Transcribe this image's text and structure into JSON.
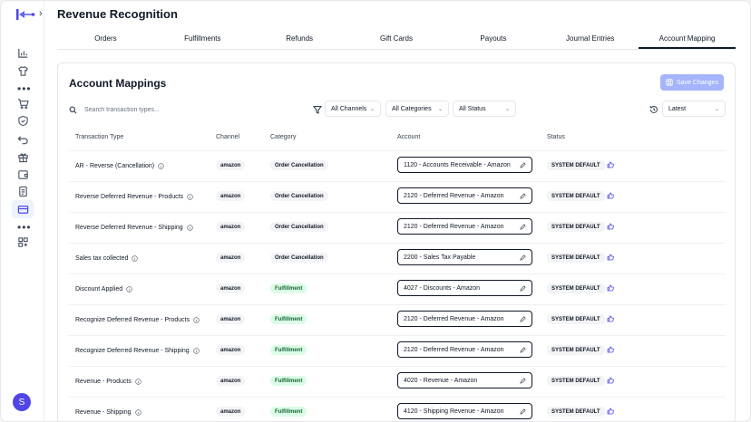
{
  "app": {
    "page_title": "Revenue Recognition",
    "user_initial": "S"
  },
  "tabs": [
    {
      "label": "Orders"
    },
    {
      "label": "Fulfillments"
    },
    {
      "label": "Refunds"
    },
    {
      "label": "Gift Cards"
    },
    {
      "label": "Payouts"
    },
    {
      "label": "Journal Entries"
    },
    {
      "label": "Account Mapping",
      "active": true
    }
  ],
  "panel": {
    "title": "Account Mappings",
    "save_label": "Save Changes",
    "search_placeholder": "Search transaction types...",
    "filters": {
      "channel": "All Channels",
      "category": "All Categories",
      "status": "All Status",
      "version": "Latest"
    }
  },
  "table": {
    "headers": {
      "type": "Transaction Type",
      "channel": "Channel",
      "category": "Category",
      "account": "Account",
      "status": "Status"
    },
    "rows": [
      {
        "type": "AR - Reverse (Cancellation)",
        "channel": "amazon",
        "category": "Order Cancellation",
        "account": "1120 - Accounts Receivable - Amazon",
        "status": "SYSTEM DEFAULT"
      },
      {
        "type": "Reverse Deferred Revenue - Products",
        "channel": "amazon",
        "category": "Order Cancellation",
        "account": "2120 - Deferred Revenue - Amazon",
        "status": "SYSTEM DEFAULT"
      },
      {
        "type": "Reverse Deferred Revenue - Shipping",
        "channel": "amazon",
        "category": "Order Cancellation",
        "account": "2120 - Deferred Revenue - Amazon",
        "status": "SYSTEM DEFAULT"
      },
      {
        "type": "Sales tax collected",
        "channel": "amazon",
        "category": "Order Cancellation",
        "account": "2200 - Sales Tax Payable",
        "status": "SYSTEM DEFAULT"
      },
      {
        "type": "Discount Applied",
        "channel": "amazon",
        "category": "Fulfillment",
        "account": "4027 - Discounts - Amazon",
        "status": "SYSTEM DEFAULT"
      },
      {
        "type": "Recognize Deferred Revenue - Products",
        "channel": "amazon",
        "category": "Fulfillment",
        "account": "2120 - Deferred Revenue - Amazon",
        "status": "SYSTEM DEFAULT"
      },
      {
        "type": "Recognize Deferred Revenue - Shipping",
        "channel": "amazon",
        "category": "Fulfillment",
        "account": "2120 - Deferred Revenue - Amazon",
        "status": "SYSTEM DEFAULT"
      },
      {
        "type": "Revenue - Products",
        "channel": "amazon",
        "category": "Fulfillment",
        "account": "4020 - Revenue - Amazon",
        "status": "SYSTEM DEFAULT"
      },
      {
        "type": "Revenue - Shipping",
        "channel": "amazon",
        "category": "Fulfillment",
        "account": "4120 - Shipping Revenue - Amazon",
        "status": "SYSTEM DEFAULT"
      }
    ]
  },
  "colors": {
    "accent": "#4f46e5",
    "save_button": "#a5b4fc",
    "fulfillment_chip": "#dcfce7"
  }
}
